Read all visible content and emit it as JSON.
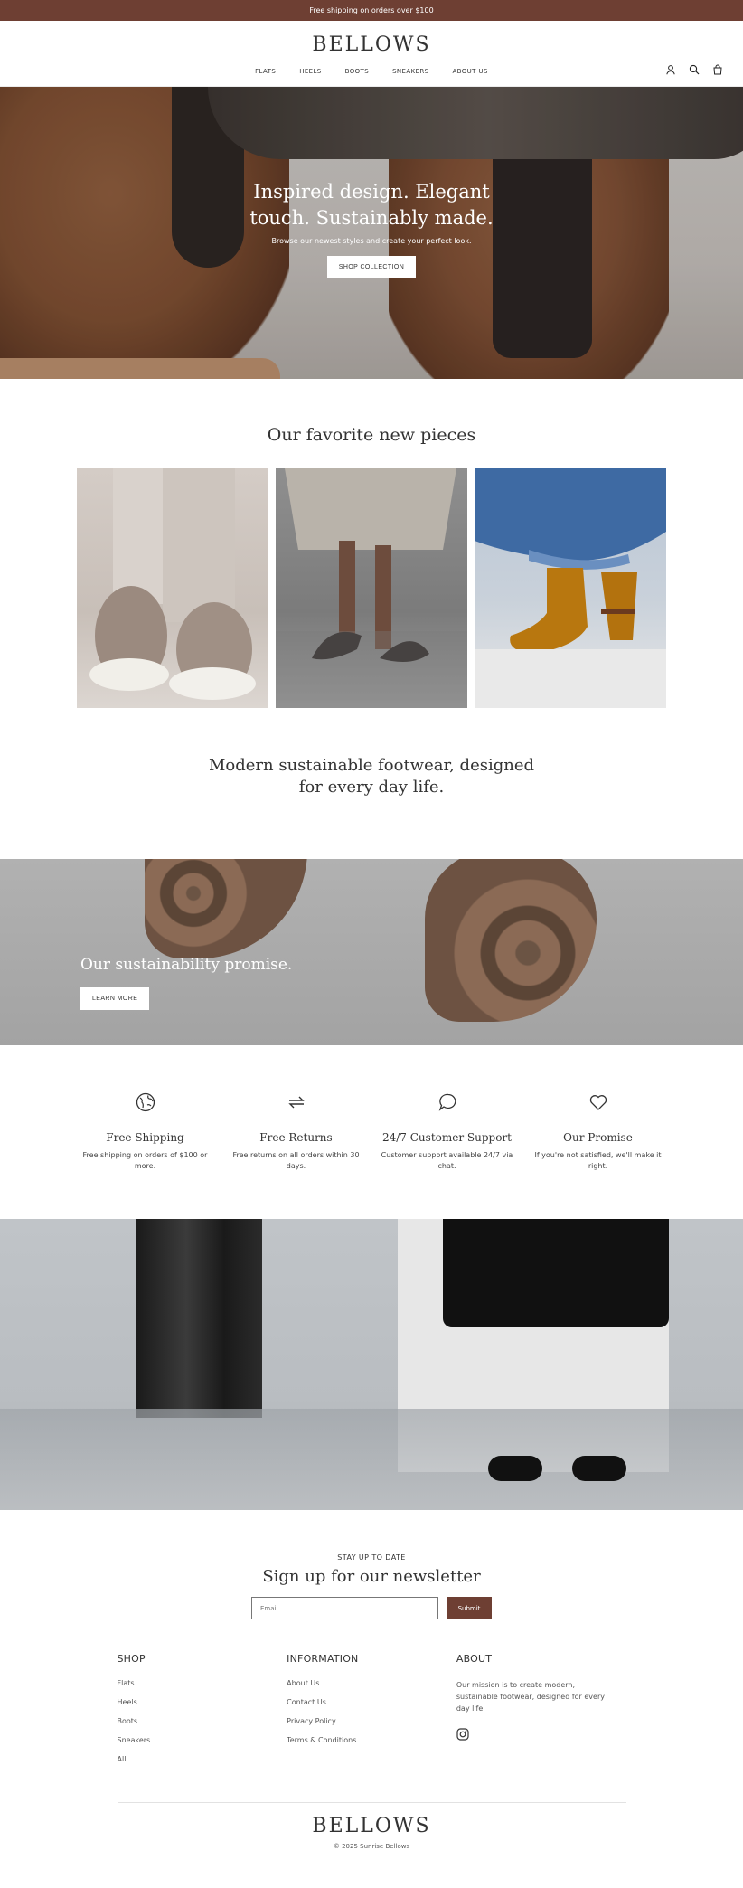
{
  "announcement": {
    "text": "Free shipping on orders over $100"
  },
  "header": {
    "logo": "BELLOWS",
    "nav": [
      "FLATS",
      "HEELS",
      "BOOTS",
      "SNEAKERS",
      "ABOUT US"
    ],
    "icons": [
      "account-icon",
      "search-icon",
      "cart-icon"
    ],
    "cart_count": "0"
  },
  "hero": {
    "title_line1": "Inspired design. Elegant",
    "title_line2": "touch. Sustainably made.",
    "subtitle": "Browse our newest styles and create your perfect look.",
    "button": "SHOP COLLECTION"
  },
  "favorites": {
    "title": "Our favorite new pieces"
  },
  "mission": {
    "line1": "Modern sustainable footwear, designed",
    "line2": "for every day life."
  },
  "promise_banner": {
    "title": "Our sustainability promise.",
    "button": "LEARN MORE"
  },
  "features": [
    {
      "icon": "globe-icon",
      "title": "Free Shipping",
      "text": "Free shipping on orders of $100 or more."
    },
    {
      "icon": "returns-icon",
      "title": "Free Returns",
      "text": "Free returns on all orders within 30 days."
    },
    {
      "icon": "chat-icon",
      "title": "24/7 Customer Support",
      "text": "Customer support available 24/7 via chat."
    },
    {
      "icon": "heart-icon",
      "title": "Our Promise",
      "text": "If you're not satisfied, we'll make it right."
    }
  ],
  "newsletter": {
    "eyebrow": "STAY UP TO DATE",
    "title": "Sign up for our newsletter",
    "placeholder": "Email",
    "submit": "Submit"
  },
  "footer": {
    "shop": {
      "heading": "SHOP",
      "links": [
        "Flats",
        "Heels",
        "Boots",
        "Sneakers",
        "All"
      ]
    },
    "information": {
      "heading": "INFORMATION",
      "links": [
        "About Us",
        "Contact Us",
        "Privacy Policy",
        "Terms & Conditions"
      ]
    },
    "about": {
      "heading": "ABOUT",
      "text": "Our mission is to create modern, sustainable footwear, designed for every day life.",
      "social_icon": "instagram-icon"
    },
    "logo": "BELLOWS",
    "copyright": "© 2025 Sunrise Bellows"
  },
  "colors": {
    "brand": "#6e3f33",
    "text": "#2b2b2b"
  }
}
